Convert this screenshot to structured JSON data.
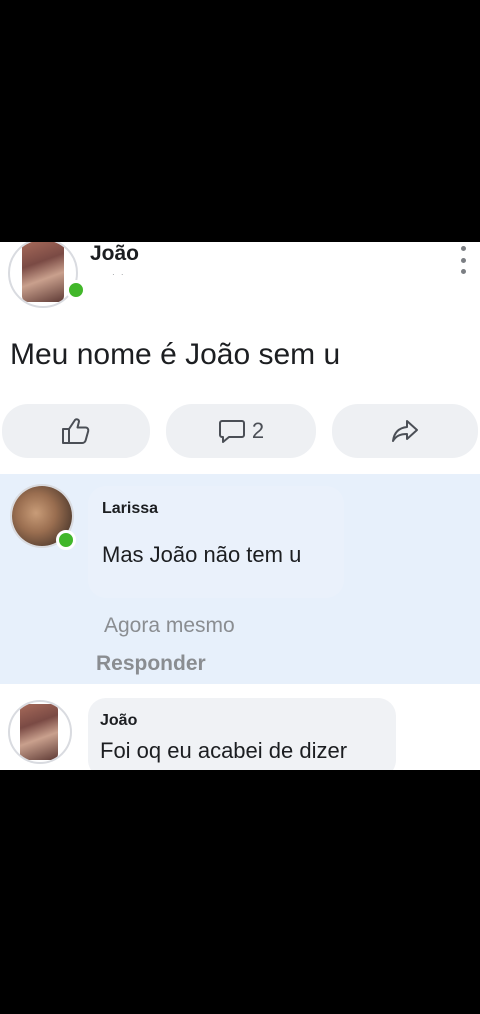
{
  "post": {
    "author": "João",
    "text": "Meu nome é João sem u",
    "actions": {
      "like_icon": "thumbs-up-icon",
      "comment_icon": "comment-icon",
      "comment_count": "2",
      "share_icon": "share-icon"
    }
  },
  "comments": [
    {
      "author": "Larissa",
      "text": "Mas João não tem u",
      "time": "Agora mesmo",
      "reply_label": "Responder"
    },
    {
      "author": "João",
      "text": "Foi oq eu acabei de dizer"
    }
  ],
  "colors": {
    "online": "#42b72a",
    "highlight": "#e7f0fb",
    "button_bg": "#eef0f3"
  }
}
